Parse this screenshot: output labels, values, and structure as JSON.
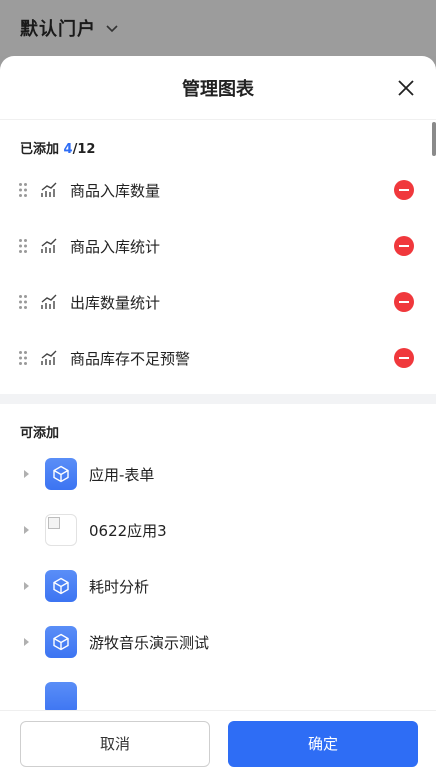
{
  "backdrop": {
    "portal_title": "默认门户"
  },
  "sheet": {
    "title": "管理图表",
    "added": {
      "heading": "已添加",
      "count_current": "4",
      "count_total": "/12",
      "items": [
        {
          "label": "商品入库数量"
        },
        {
          "label": "商品入库统计"
        },
        {
          "label": "出库数量统计"
        },
        {
          "label": "商品库存不足预警"
        }
      ]
    },
    "available": {
      "heading": "可添加",
      "items": [
        {
          "label": "应用-表单",
          "icon": "cube-icon"
        },
        {
          "label": "0622应用3",
          "icon": "broken-image-icon"
        },
        {
          "label": "耗时分析",
          "icon": "cube-icon"
        },
        {
          "label": "游牧音乐演示测试",
          "icon": "cube-icon"
        }
      ]
    },
    "footer": {
      "cancel_label": "取消",
      "confirm_label": "确定"
    }
  },
  "colors": {
    "accent": "#2e6df5",
    "danger": "#f0383c",
    "app_icon": "#4a80f5"
  }
}
